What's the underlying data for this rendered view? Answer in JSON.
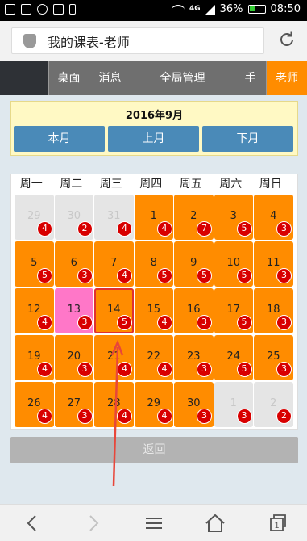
{
  "status_bar": {
    "signal": "4G",
    "battery": "36%",
    "time": "08:50"
  },
  "browser": {
    "page_title": "我的课表-老师"
  },
  "nav": {
    "tabs": [
      {
        "label": ""
      },
      {
        "label": "桌面"
      },
      {
        "label": "消息"
      },
      {
        "label": "全局管理"
      },
      {
        "label": "手"
      },
      {
        "label": "老师"
      }
    ]
  },
  "month_selector": {
    "title": "2016年9月",
    "this_month": "本月",
    "prev_month": "上月",
    "next_month": "下月"
  },
  "calendar": {
    "weekdays": [
      "周一",
      "周二",
      "周三",
      "周四",
      "周五",
      "周六",
      "周日"
    ],
    "days": [
      {
        "num": "29",
        "count": "4",
        "kind": "other"
      },
      {
        "num": "30",
        "count": "2",
        "kind": "other"
      },
      {
        "num": "31",
        "count": "4",
        "kind": "other"
      },
      {
        "num": "1",
        "count": "4",
        "kind": "current"
      },
      {
        "num": "2",
        "count": "7",
        "kind": "current"
      },
      {
        "num": "3",
        "count": "5",
        "kind": "current"
      },
      {
        "num": "4",
        "count": "3",
        "kind": "current"
      },
      {
        "num": "5",
        "count": "5",
        "kind": "current"
      },
      {
        "num": "6",
        "count": "3",
        "kind": "current"
      },
      {
        "num": "7",
        "count": "4",
        "kind": "current"
      },
      {
        "num": "8",
        "count": "5",
        "kind": "current"
      },
      {
        "num": "9",
        "count": "5",
        "kind": "current"
      },
      {
        "num": "10",
        "count": "5",
        "kind": "current"
      },
      {
        "num": "11",
        "count": "3",
        "kind": "current"
      },
      {
        "num": "12",
        "count": "4",
        "kind": "current"
      },
      {
        "num": "13",
        "count": "3",
        "kind": "highlight"
      },
      {
        "num": "14",
        "count": "5",
        "kind": "today"
      },
      {
        "num": "15",
        "count": "4",
        "kind": "current"
      },
      {
        "num": "16",
        "count": "3",
        "kind": "current"
      },
      {
        "num": "17",
        "count": "5",
        "kind": "current"
      },
      {
        "num": "18",
        "count": "3",
        "kind": "current"
      },
      {
        "num": "19",
        "count": "4",
        "kind": "current"
      },
      {
        "num": "20",
        "count": "3",
        "kind": "current"
      },
      {
        "num": "21",
        "count": "4",
        "kind": "current"
      },
      {
        "num": "22",
        "count": "4",
        "kind": "current"
      },
      {
        "num": "23",
        "count": "3",
        "kind": "current"
      },
      {
        "num": "24",
        "count": "5",
        "kind": "current"
      },
      {
        "num": "25",
        "count": "3",
        "kind": "current"
      },
      {
        "num": "26",
        "count": "4",
        "kind": "current"
      },
      {
        "num": "27",
        "count": "3",
        "kind": "current"
      },
      {
        "num": "28",
        "count": "4",
        "kind": "current"
      },
      {
        "num": "29",
        "count": "4",
        "kind": "current"
      },
      {
        "num": "30",
        "count": "3",
        "kind": "current"
      },
      {
        "num": "1",
        "count": "3",
        "kind": "other"
      },
      {
        "num": "2",
        "count": "2",
        "kind": "other"
      }
    ]
  },
  "back_button": "返回",
  "colors": {
    "accent": "#ff8c00",
    "button_blue": "#4a8ab8",
    "badge_red": "#d80000",
    "highlight_pink": "#ff77c8"
  }
}
